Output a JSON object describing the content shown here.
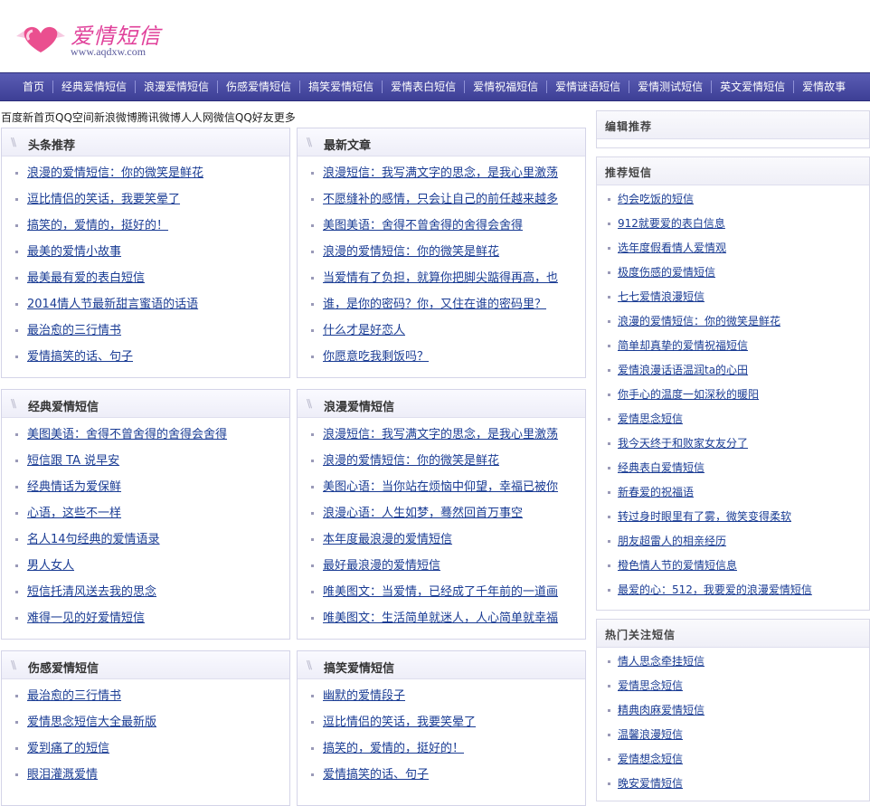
{
  "header": {
    "logo_title": "爱情短信",
    "logo_url": "www.aqdxw.com"
  },
  "nav": [
    "首页",
    "经典爱情短信",
    "浪漫爱情短信",
    "伤感爱情短信",
    "搞笑爱情短信",
    "爱情表白短信",
    "爱情祝福短信",
    "爱情谜语短信",
    "爱情测试短信",
    "英文爱情短信",
    "爱情故事"
  ],
  "friend_links": "百度新首页QQ空间新浪微博腾讯微博人人网微信QQ好友更多",
  "boxes": [
    {
      "title": "头条推荐",
      "items": [
        "浪漫的爱情短信：你的微笑是鲜花",
        "逗比情侣的笑话，我要笑晕了",
        "搞笑的，爱情的，挺好的！",
        "最美的爱情小故事",
        "最美最有爱的表白短信",
        "2014情人节最新甜言蜜语的话语",
        "最治愈的三行情书",
        "爱情搞笑的话、句子"
      ]
    },
    {
      "title": "最新文章",
      "items": [
        "浪漫短信：我写满文字的思念，是我心里激荡",
        "不愿缝补的感情，只会让自己的前任越来越多",
        "美图美语：舍得不曾舍得的舍得会舍得",
        "浪漫的爱情短信：你的微笑是鲜花",
        "当爱情有了负担，就算你把脚尖踮得再高，也",
        "谁，是你的密码？你，又住在谁的密码里？",
        "什么才是好恋人",
        "你愿意吃我剩饭吗？"
      ]
    },
    {
      "title": "经典爱情短信",
      "items": [
        "美图美语：舍得不曾舍得的舍得会舍得",
        "短信跟 TA 说早安",
        "经典情话为爱保鲜",
        "心语，这些不一样",
        "名人14句经典的爱情语录",
        "男人女人",
        "短信托清风送去我的思念",
        "难得一见的好爱情短信"
      ]
    },
    {
      "title": "浪漫爱情短信",
      "items": [
        "浪漫短信：我写满文字的思念，是我心里激荡",
        "浪漫的爱情短信：你的微笑是鲜花",
        "美图心语：当你站在烦恼中仰望，幸福已被你",
        "浪漫心语：人生如梦，蓦然回首万事空",
        "本年度最浪漫的爱情短信",
        "最好最浪漫的爱情短信",
        "唯美图文：当爱情，已经成了千年前的一道画",
        "唯美图文：生活简单就迷人，人心简单就幸福"
      ]
    },
    {
      "title": "伤感爱情短信",
      "items": [
        "最治愈的三行情书",
        "爱情思念短信大全最新版",
        "爱到痛了的短信",
        "眼泪灌溉爱情"
      ]
    },
    {
      "title": "搞笑爱情短信",
      "items": [
        "幽默的爱情段子",
        "逗比情侣的笑话，我要笑晕了",
        "搞笑的，爱情的，挺好的！",
        "爱情搞笑的话、句子"
      ]
    }
  ],
  "sidebar": {
    "editor_pick": {
      "title": "编辑推荐"
    },
    "recommend": {
      "title": "推荐短信",
      "items": [
        "约会吃饭的短信",
        "912就要爱的表白信息",
        "选年度假看情人爱情观",
        "极度伤感的爱情短信",
        "七七爱情浪漫短信",
        "浪漫的爱情短信：你的微笑是鲜花",
        "简单却真挚的爱情祝福短信",
        "爱情浪漫话语温润ta的心田",
        "你手心的温度一如深秋的暖阳",
        "爱情思念短信",
        "我今天终于和败家女友分了",
        "经典表白爱情短信",
        "新春爱的祝福语",
        "转过身时眼里有了雾，微笑变得柔软",
        "朋友超雷人的相亲经历",
        "橙色情人节的爱情短信息",
        "最爱的心：512，我要爱的浪漫爱情短信"
      ]
    },
    "hot": {
      "title": "热门关注短信",
      "items": [
        "情人思念牵挂短信",
        "爱情思念短信",
        "精典肉麻爱情短信",
        "温馨浪漫短信",
        "爱情想念短信",
        "晚安爱情短信"
      ]
    }
  }
}
